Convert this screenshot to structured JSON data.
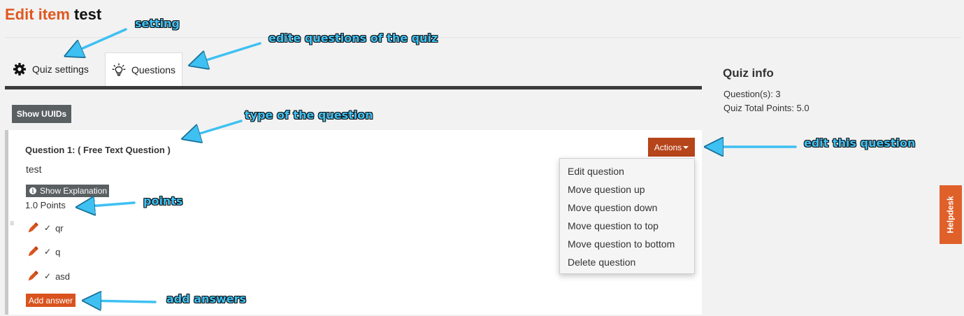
{
  "page": {
    "title_prefix": "Edit item",
    "title_name": "test"
  },
  "tabs": [
    {
      "label": "Quiz settings",
      "icon": "gear-icon",
      "active": false
    },
    {
      "label": "Questions",
      "icon": "lightbulb-icon",
      "active": true
    }
  ],
  "toolbar": {
    "show_uuids_label": "Show UUIDs"
  },
  "question": {
    "title": "Question 1: ( Free Text Question )",
    "text": "test",
    "show_explanation_label": "Show Explanation",
    "points": "1.0 Points",
    "answers": [
      {
        "text": "qr"
      },
      {
        "text": "q"
      },
      {
        "text": "asd"
      }
    ],
    "add_answer_label": "Add answer"
  },
  "actions": {
    "label": "Actions",
    "menu": [
      "Edit question",
      "Move question up",
      "Move question down",
      "Move question to top",
      "Move question to bottom",
      "Delete question"
    ]
  },
  "quiz_info": {
    "title": "Quiz info",
    "questions": "Question(s): 3",
    "total_points": "Quiz Total Points: 5.0"
  },
  "helpdesk": {
    "label": "Helpdesk"
  },
  "annotations": {
    "setting": "setting",
    "edit_questions": "edite questions of the quiz",
    "type": "type of  the question",
    "edit_this": "edit this question",
    "points": "points",
    "add_answers": "add answers"
  },
  "colors": {
    "accent": "#e0581f",
    "actions_button": "#b6451a",
    "dark_button": "#5a5f62",
    "annotation": "#3ec0f2"
  }
}
